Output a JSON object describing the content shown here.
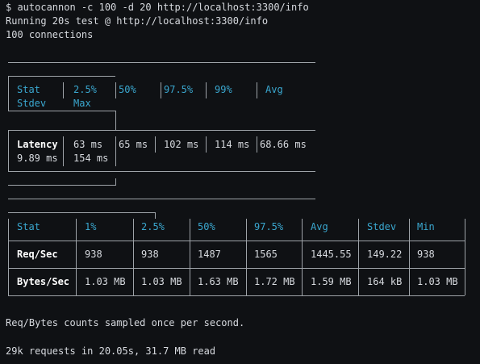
{
  "prompt": {
    "command": "$ autocannon -c 100 -d 20 http://localhost:3300/info",
    "running": "Running 20s test @ http://localhost:3300/info",
    "connections": "100 connections"
  },
  "latency_table": {
    "headers": [
      "Stat",
      "2.5%",
      "50%",
      "97.5%",
      "99%",
      "Avg",
      "Stdev",
      "Max"
    ],
    "row": {
      "label": "Latency",
      "values": [
        "63 ms",
        "65 ms",
        "102 ms",
        "114 ms",
        "68.66 ms",
        "9.89 ms",
        "154 ms"
      ]
    }
  },
  "throughput_table": {
    "headers": [
      "Stat",
      "1%",
      "2.5%",
      "50%",
      "97.5%",
      "Avg",
      "Stdev",
      "Min"
    ],
    "rows": [
      {
        "label": "Req/Sec",
        "values": [
          "938",
          "938",
          "1487",
          "1565",
          "1445.55",
          "149.22",
          "938"
        ]
      },
      {
        "label": "Bytes/Sec",
        "values": [
          "1.03 MB",
          "1.03 MB",
          "1.63 MB",
          "1.72 MB",
          "1.59 MB",
          "164 kB",
          "1.03 MB"
        ]
      }
    ]
  },
  "footer": {
    "sampled_note": "Req/Bytes counts sampled once per second.",
    "summary": "29k requests in 20.05s, 31.7 MB read"
  },
  "colors": {
    "background": "#0f1114",
    "text": "#d7dadf",
    "header_accent": "#3aa7cf",
    "table_border": "#9ea3a8"
  }
}
